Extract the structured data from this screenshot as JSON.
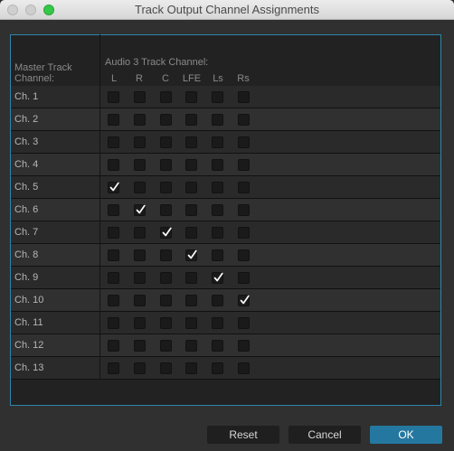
{
  "window": {
    "title": "Track Output Channel Assignments"
  },
  "headers": {
    "master": "Master Track Channel:",
    "audio": "Audio 3 Track Channel:",
    "columns": [
      "L",
      "R",
      "C",
      "LFE",
      "Ls",
      "Rs"
    ]
  },
  "rows": [
    {
      "label": "Ch. 1",
      "checked": null
    },
    {
      "label": "Ch. 2",
      "checked": null
    },
    {
      "label": "Ch. 3",
      "checked": null
    },
    {
      "label": "Ch. 4",
      "checked": null
    },
    {
      "label": "Ch. 5",
      "checked": 0
    },
    {
      "label": "Ch. 6",
      "checked": 1
    },
    {
      "label": "Ch. 7",
      "checked": 2
    },
    {
      "label": "Ch. 8",
      "checked": 3
    },
    {
      "label": "Ch. 9",
      "checked": 4
    },
    {
      "label": "Ch. 10",
      "checked": 5
    },
    {
      "label": "Ch. 11",
      "checked": null
    },
    {
      "label": "Ch. 12",
      "checked": null
    },
    {
      "label": "Ch. 13",
      "checked": null
    }
  ],
  "buttons": {
    "reset": "Reset",
    "cancel": "Cancel",
    "ok": "OK"
  },
  "colors": {
    "accent": "#2478a0",
    "panel_border": "#2f86a8"
  }
}
